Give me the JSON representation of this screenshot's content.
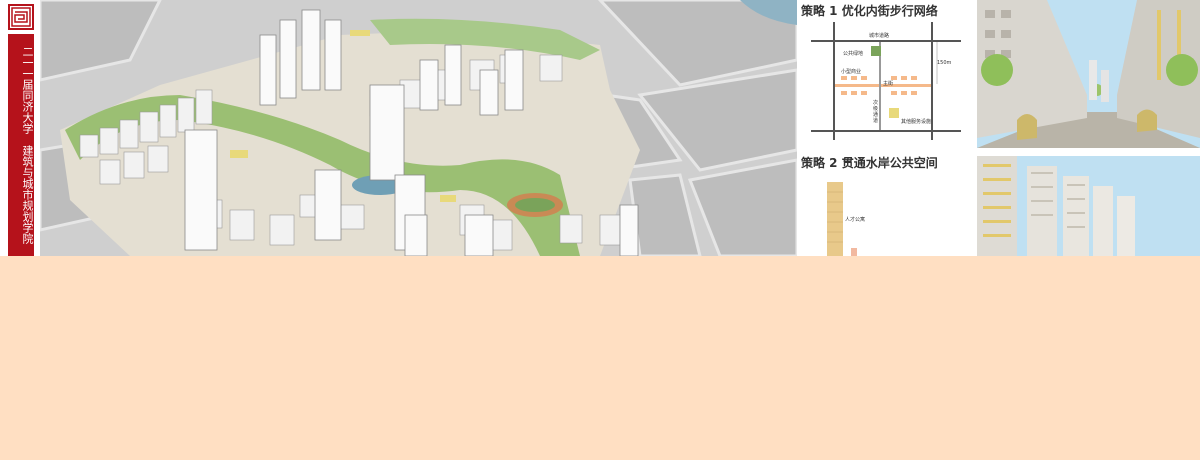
{
  "banner": {
    "vertical_text": "二一一届同济大学　建筑与城市规划学院"
  },
  "strategy1": {
    "title": "策略 1  优化内街步行网络",
    "labels": {
      "city_road": "城市道路",
      "public_green": "公共绿地",
      "small_square": "小型商业",
      "main_street": "主街",
      "secondary": "次级通道",
      "facility": "其他服务设施",
      "distance": "150m"
    }
  },
  "strategy2": {
    "title": "策略 2  贯通水岸公共空间",
    "labels": {
      "talent_apartment": "人才公寓"
    }
  },
  "colors": {
    "banner_red": "#b5121b",
    "page_bg": "#ffdfc2",
    "street_orange": "#f5b98a",
    "green": "#7aa35a"
  }
}
